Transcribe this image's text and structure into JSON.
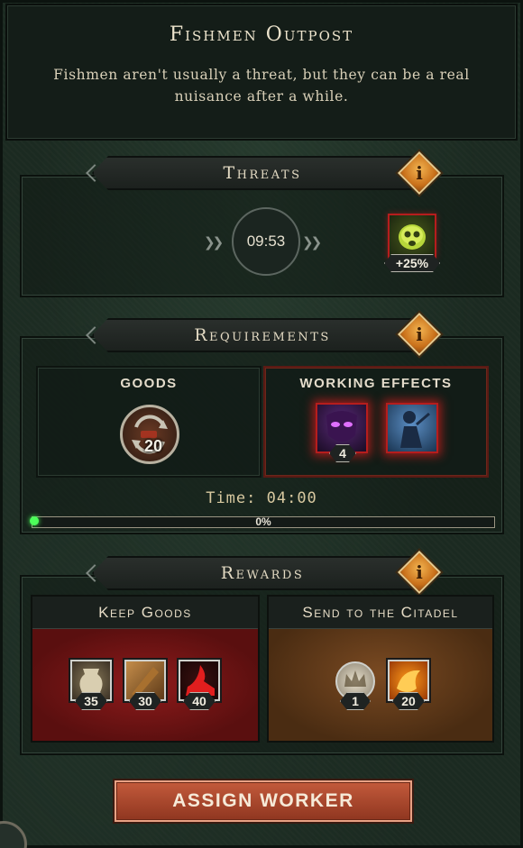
{
  "header": {
    "title": "Fishmen Outpost",
    "description": "Fishmen aren't usually a threat, but they can be a real nuisance after a while."
  },
  "threats": {
    "section_label": "Threats",
    "info_icon": "i",
    "timer": "09:53",
    "threat_icon": "slime-skull-icon",
    "threat_badge": "+25%"
  },
  "requirements": {
    "section_label": "Requirements",
    "info_icon": "i",
    "goods": {
      "title": "GOODS",
      "icon": "goods-cycle-icon",
      "amount": "20"
    },
    "working_effects": {
      "title": "WORKING EFFECTS",
      "effects": [
        {
          "icon": "purple-mask-icon",
          "count": "4"
        },
        {
          "icon": "blue-figure-icon",
          "count": ""
        }
      ]
    },
    "time_label": "Time: 04:00",
    "progress": {
      "value": 0,
      "label": "0%"
    }
  },
  "rewards": {
    "section_label": "Rewards",
    "info_icon": "i",
    "keep": {
      "title": "Keep Goods",
      "items": [
        {
          "icon": "clay-pot-icon",
          "amount": "35"
        },
        {
          "icon": "wooden-plank-icon",
          "amount": "30"
        },
        {
          "icon": "red-cloth-icon",
          "amount": "40"
        }
      ]
    },
    "send": {
      "title": "Send to the Citadel",
      "items": [
        {
          "icon": "crown-coin-icon",
          "amount": "1"
        },
        {
          "icon": "amber-resource-icon",
          "amount": "20"
        }
      ]
    }
  },
  "action": {
    "assign_label": "ASSIGN WORKER"
  },
  "colors": {
    "accent_orange": "#e08a2a",
    "threat_red": "#b61d1d",
    "button": "#b04a2e",
    "progress_green": "#4caf50"
  }
}
